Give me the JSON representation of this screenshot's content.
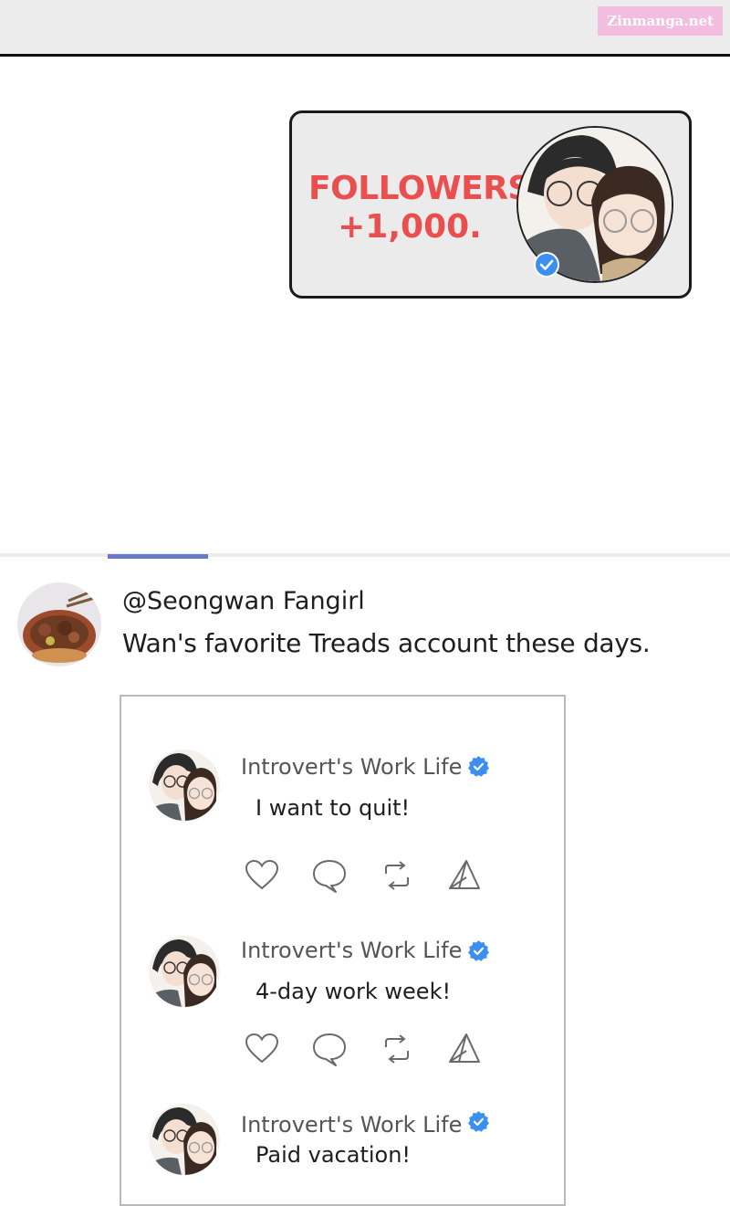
{
  "watermark": "Zinmanga.net",
  "followers_card": {
    "line1": "FOLLOWERS",
    "line2": "+1,000."
  },
  "post": {
    "username": "@Seongwan Fangirl",
    "text": "Wan's favorite Treads account these days."
  },
  "embedded_posts": [
    {
      "account": "Introvert's Work Life",
      "text": "I want to quit!"
    },
    {
      "account": "Introvert's Work Life",
      "text": "4-day work week!"
    },
    {
      "account": "Introvert's Work Life",
      "text": "Paid vacation!"
    }
  ],
  "icons": [
    "heart-icon",
    "comment-icon",
    "repost-icon",
    "share-icon",
    "verified-icon"
  ],
  "colors": {
    "followers_text": "#ea4f4f",
    "verified": "#3b8ff0",
    "tab_indicator": "#6a78c8"
  }
}
